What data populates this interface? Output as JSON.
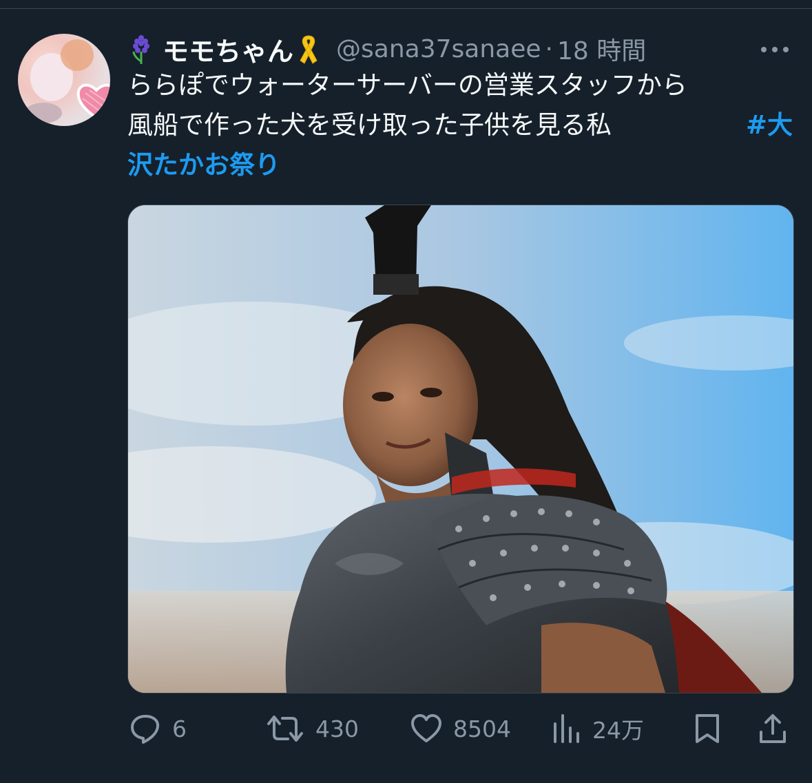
{
  "user": {
    "display_name": "モモちゃん",
    "handle": "@sana37sanaee",
    "separator": "·",
    "time": "18 時間",
    "name_emoji_left": "hyacinth-icon",
    "name_emoji_right": "yellow-ribbon-icon"
  },
  "tweet": {
    "text_line1": "ららぽでウォーターサーバーの営業スタッフから",
    "text_line2": "風船で作った犬を受け取った子供を見る私",
    "hashtag_part1": "#大",
    "hashtag_part2": "沢たかお祭り"
  },
  "actions": {
    "replies": "6",
    "retweets": "430",
    "likes": "8504",
    "views": "24万"
  },
  "colors": {
    "background": "#15202b",
    "text": "#f7f9f9",
    "secondary": "#8b98a5",
    "link": "#1d9bf0"
  }
}
